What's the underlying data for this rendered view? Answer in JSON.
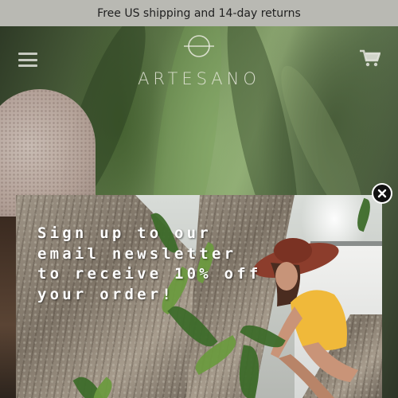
{
  "announcement": {
    "text": "Free US shipping and 14-day returns"
  },
  "header": {
    "brand": "ARTESANO",
    "menu_icon": "hamburger-menu-icon",
    "cart_icon": "shopping-cart-icon",
    "logo_icon": "circle-crossed-logo-icon"
  },
  "popup": {
    "headline": "Sign up to our email newsletter to receive 10% off your order!",
    "close_icon": "close-icon"
  },
  "colors": {
    "announcement_bg": "#b9b9b3",
    "announcement_text": "#1f1f1f",
    "close_button": "#111111",
    "popup_text": "#ffffff"
  }
}
